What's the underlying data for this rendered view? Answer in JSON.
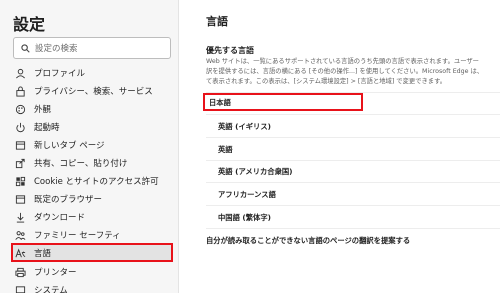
{
  "sidebar": {
    "title": "設定",
    "search_placeholder": "設定の検索",
    "items": [
      {
        "label": "プロファイル",
        "icon": "profile-icon"
      },
      {
        "label": "プライバシー、検索、サービス",
        "icon": "lock-icon"
      },
      {
        "label": "外観",
        "icon": "appearance-icon"
      },
      {
        "label": "起動時",
        "icon": "power-icon"
      },
      {
        "label": "新しいタブ ページ",
        "icon": "new-tab-icon"
      },
      {
        "label": "共有、コピー、貼り付け",
        "icon": "share-icon"
      },
      {
        "label": "Cookie とサイトのアクセス許可",
        "icon": "cookie-icon"
      },
      {
        "label": "既定のブラウザー",
        "icon": "browser-icon"
      },
      {
        "label": "ダウンロード",
        "icon": "download-icon"
      },
      {
        "label": "ファミリー セーフティ",
        "icon": "family-icon"
      },
      {
        "label": "言語",
        "icon": "language-icon"
      },
      {
        "label": "プリンター",
        "icon": "printer-icon"
      },
      {
        "label": "システム",
        "icon": "system-icon"
      }
    ]
  },
  "main": {
    "title": "言語",
    "preferred_heading": "優先する言語",
    "description_lines": [
      "Web サイトは、一覧にあるサポートされている言語のうち先頭の言語で表示されます。ユーザー",
      "訳を提供するには、言語の横にある [その他の操作...] を使用してください。Microsoft Edge は、",
      "て表示されます。この表示は、[システム環境設定] > [言語と地域] で変更できます。"
    ],
    "languages": [
      "日本語",
      "英語 (イギリス)",
      "英語",
      "英語 (アメリカ合衆国)",
      "アフリカーンス語",
      "中国語 (繁体字)"
    ],
    "translate_offer": "自分が読み取ることができない言語のページの翻訳を提案する"
  },
  "colors": {
    "highlight": "#e8121a",
    "sidebar_bg": "#f6f6f6",
    "active_bg": "#e3e3e3"
  }
}
